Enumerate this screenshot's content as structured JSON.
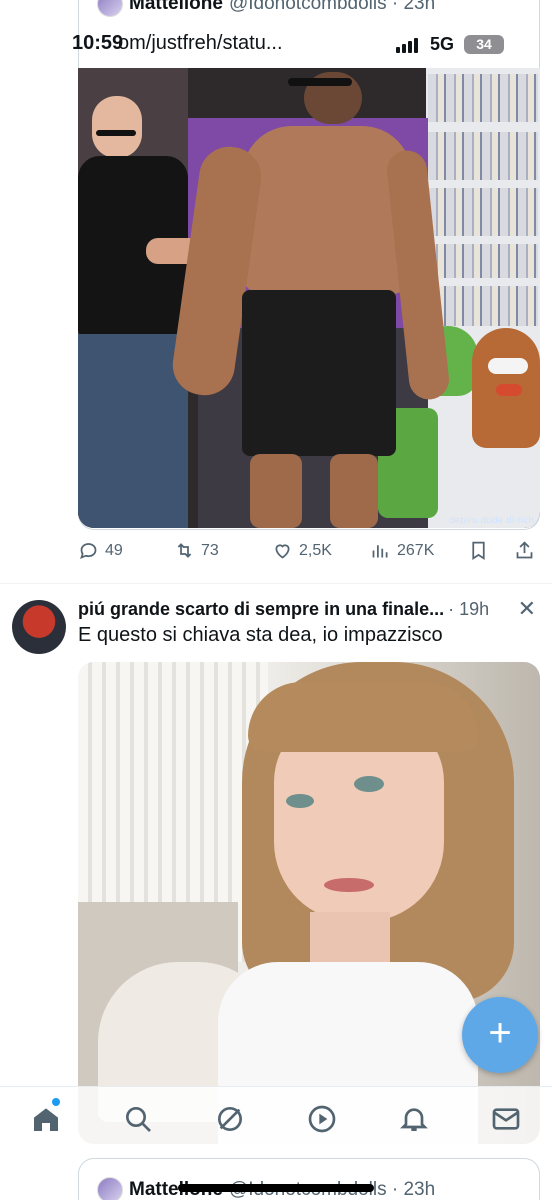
{
  "status_bar": {
    "time": "10:59",
    "url": "om/justfreh/statu...",
    "network": "5G",
    "battery": "34"
  },
  "top_quote": {
    "author_name": "Mattellone",
    "author_handle": "@Idonotcombdolls · 23h",
    "photo_caption": "debiru dude di rich"
  },
  "top_post_actions": {
    "replies": "49",
    "reposts": "73",
    "likes": "2,5K",
    "views": "267K"
  },
  "post2": {
    "author_name": "piú grande scarto di sempre in una finale...",
    "time": "· 19h",
    "close_symbol": "✕",
    "text": "E questo si chiava sta dea, io impazzisco"
  },
  "fab": {
    "symbol": "+"
  },
  "tabbar": {
    "icons": [
      "home-icon",
      "search-icon",
      "grok-icon",
      "video-icon",
      "notifications-icon",
      "messages-icon"
    ]
  },
  "bottom_quote": {
    "author_name": "Mattellone",
    "author_handle": "@Idonotcombdolls · 23h"
  },
  "colors": {
    "accent": "#1d9bf0",
    "fab": "#5fa8e8",
    "muted_text": "#536471",
    "border": "#cfd9de"
  }
}
